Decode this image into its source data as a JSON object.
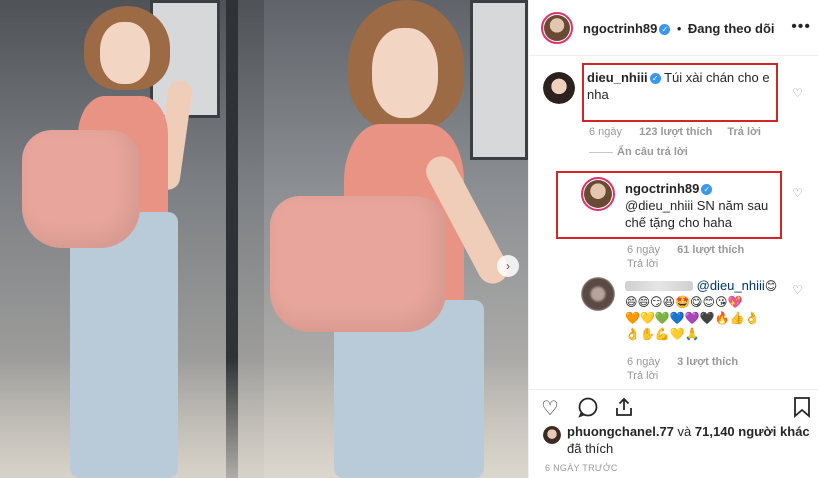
{
  "header": {
    "username": "ngoctrinh89",
    "separator": "•",
    "follow_label": "Đang theo dõi",
    "more_icon": "more-icon"
  },
  "comments": [
    {
      "username": "dieu_nhiii",
      "text": "Túi xài chán cho e nha",
      "age": "6 ngày",
      "likes": "123 lượt thích",
      "reply_label": "Trả lời",
      "hide_replies_label": "Ẩn câu trả lời"
    },
    {
      "username": "ngoctrinh89",
      "text": "@dieu_nhiii SN năm sau chế tặng cho haha",
      "age": "6 ngày",
      "likes": "61 lượt thích",
      "reply_label": "Trả lời"
    },
    {
      "mention": "@dieu_nhiii",
      "emoji_line_1": "😊",
      "emoji_line_2": "😄😄😏😆🤩😋😊😘💖",
      "emoji_line_3": "🧡💛💚💙💜🖤🔥👍👌",
      "emoji_line_4": "👌✋💪💛🙏",
      "age": "6 ngày",
      "likes": "3 lượt thích",
      "reply_label": "Trả lời"
    }
  ],
  "likes_row": {
    "first_user": "phuongchanel.77",
    "connector": "và",
    "others": "71,140 người khác",
    "suffix": "đã thích"
  },
  "post_time": "6 NGÀY TRƯỚC",
  "colors": {
    "highlight_box": "#d32525",
    "verified": "#3897f0",
    "story_ring": "#e1306c"
  }
}
